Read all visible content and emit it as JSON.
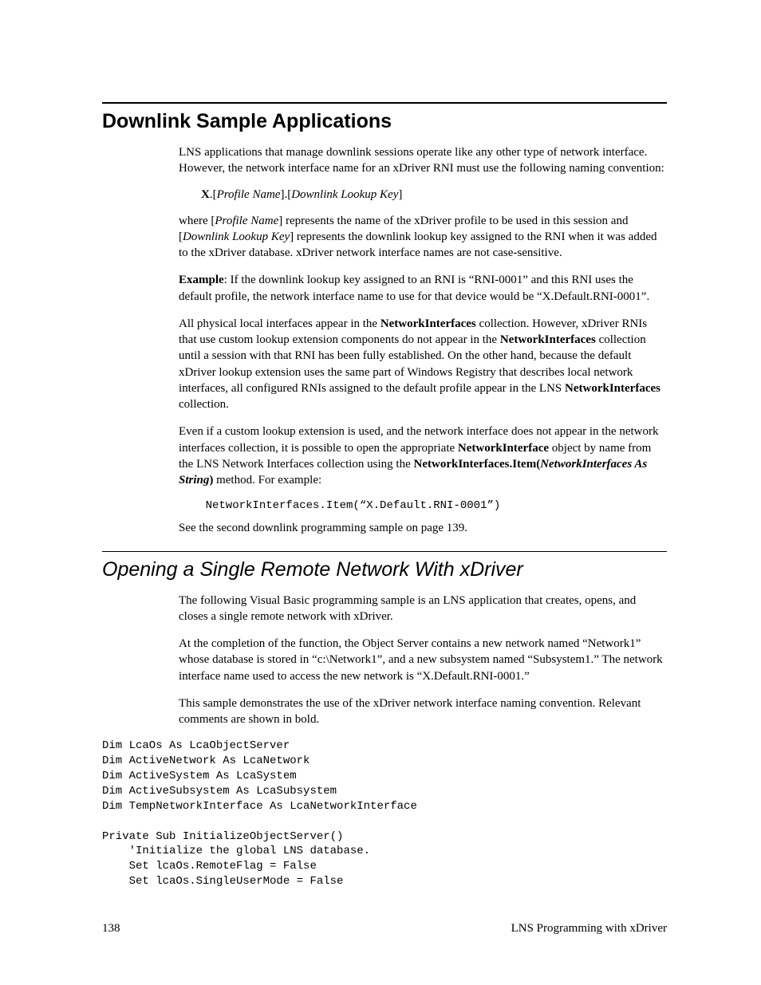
{
  "h1": "Downlink Sample Applications",
  "p1a": "LNS applications that manage downlink sessions operate like any other type of network interface.  However, the network interface name for an xDriver RNI must use the following naming convention:",
  "conv_b": "X",
  "conv_rest": ".[",
  "conv_i1": "Profile Name",
  "conv_mid": "].[",
  "conv_i2": "Downlink Lookup Key",
  "conv_end": "]",
  "p2a": "where [",
  "p2i1": "Profile Name",
  "p2b": "] represents the name of the xDriver profile to be used in this session and [",
  "p2i2": "Downlink Lookup Key",
  "p2c": "] represents the downlink lookup key assigned to the RNI when it was added to the xDriver database.  xDriver network interface names are not case-sensitive.",
  "p3b": "Example",
  "p3a": ":  If the downlink lookup key assigned to an RNI is “RNI-0001” and this RNI uses the default profile, the network interface name to use for that device would be “X.Default.RNI-0001”.",
  "p4a": "All physical local interfaces appear in the ",
  "p4b1": "NetworkInterfaces",
  "p4b": " collection.  However, xDriver RNIs that use custom lookup extension components do not appear in the ",
  "p4b2": "NetworkInterfaces",
  "p4c": " collection until a session with that RNI has been fully established.  On the other hand, because the default xDriver lookup extension uses the same part of Windows Registry that describes local network interfaces, all configured RNIs assigned to the default profile appear in the LNS ",
  "p4b3": "NetworkInterfaces",
  "p4d": " collection.",
  "p5a": "Even if a custom lookup extension is used, and the network interface does not appear in the network interfaces collection, it is possible to open the appropriate ",
  "p5b1": "NetworkInterface",
  "p5b": " object by name from the LNS Network Interfaces collection using the ",
  "p5b2": "NetworkInterfaces.Item(",
  "p5i": "NetworkInterfaces As String",
  "p5b3": ")",
  "p5c": " method.  For example:",
  "code1": "    NetworkInterfaces.Item(“X.Default.RNI-0001”)",
  "p6": "See the second downlink programming sample on page 139.",
  "h2": "Opening a Single Remote Network With xDriver",
  "p7": "The following Visual Basic programming sample is an LNS application that creates, opens, and closes a single remote network with xDriver.",
  "p8": "At the completion of the function, the Object Server contains a new network named “Network1” whose database is stored in “c:\\Network1”, and a new subsystem named “Subsystem1.”  The network interface name used to access the new network is “X.Default.RNI-0001.”",
  "p9": "This sample demonstrates the use of the xDriver network interface naming convention.  Relevant comments are shown in bold.",
  "code2": "Dim LcaOs As LcaObjectServer\nDim ActiveNetwork As LcaNetwork\nDim ActiveSystem As LcaSystem\nDim ActiveSubsystem As LcaSubsystem\nDim TempNetworkInterface As LcaNetworkInterface\n\nPrivate Sub InitializeObjectServer()\n    'Initialize the global LNS database.\n    Set lcaOs.RemoteFlag = False\n    Set lcaOs.SingleUserMode = False",
  "footer_left": "138",
  "footer_right": "LNS Programming with xDriver"
}
